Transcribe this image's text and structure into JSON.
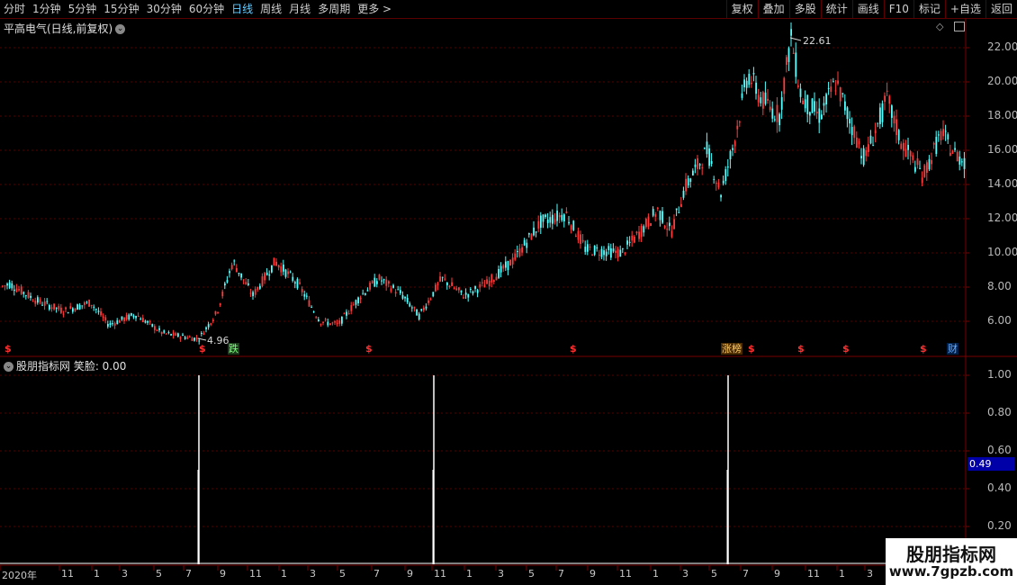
{
  "toolbar": {
    "periods": [
      "分时",
      "1分钟",
      "5分钟",
      "15分钟",
      "30分钟",
      "60分钟",
      "日线",
      "周线",
      "月线",
      "多周期",
      "更多 >"
    ],
    "active_period": "日线",
    "right_buttons": [
      "复权",
      "叠加",
      "多股",
      "统计",
      "画线",
      "F10",
      "标记",
      "+自选",
      "返回"
    ]
  },
  "main_chart": {
    "title": "平高电气(日线,前复权)",
    "price_labels": [
      "22.00",
      "20.00",
      "18.00",
      "16.00",
      "14.00",
      "12.00",
      "10.00",
      "8.00",
      "6.00"
    ],
    "high_label": "22.61",
    "low_label": "4.96",
    "tags": {
      "die": "跌",
      "zhangbang": "涨榜",
      "cai": "财"
    },
    "dollar_marker": "$"
  },
  "indicator": {
    "title": "股朋指标网  笑脸: 0.00",
    "y_labels": [
      "1.00",
      "0.80",
      "0.60",
      "0.40",
      "0.20"
    ],
    "current_value": "0.49"
  },
  "x_axis": {
    "labels": [
      "2020年",
      "11",
      "1",
      "3",
      "5",
      "7",
      "9",
      "11",
      "1",
      "3",
      "5",
      "7",
      "9",
      "11",
      "1",
      "3",
      "5",
      "7",
      "9",
      "11",
      "1",
      "3",
      "5",
      "7",
      "9",
      "11",
      "1",
      "3"
    ]
  },
  "watermark": {
    "line1": "股朋指标网",
    "line2": "www.7gpzb.com"
  },
  "chart_data": {
    "type": "candlestick",
    "title": "平高电气(日线,前复权)",
    "price_range": [
      4.5,
      23.0
    ],
    "yticks": [
      6,
      8,
      10,
      12,
      14,
      16,
      18,
      20,
      22
    ],
    "key_points": [
      {
        "label": "start",
        "value": 8.0
      },
      {
        "label": "low",
        "value": 4.96
      },
      {
        "label": "rebound",
        "value": 9.5
      },
      {
        "label": "mid",
        "value": 12.3
      },
      {
        "label": "high",
        "value": 22.61
      },
      {
        "label": "end",
        "value": 15.3
      }
    ],
    "indicator": {
      "name": "笑脸",
      "value": 0.0,
      "spikes": [
        {
          "index": 0,
          "value": 1.0
        },
        {
          "index": 1,
          "value": 1.0
        },
        {
          "index": 2,
          "value": 1.0
        }
      ],
      "ylim": [
        0,
        1.05
      ]
    }
  },
  "colors": {
    "up": "#ff3b3b",
    "down": "#54ffff",
    "grid": "#7a0000",
    "active": "#66ccff"
  }
}
